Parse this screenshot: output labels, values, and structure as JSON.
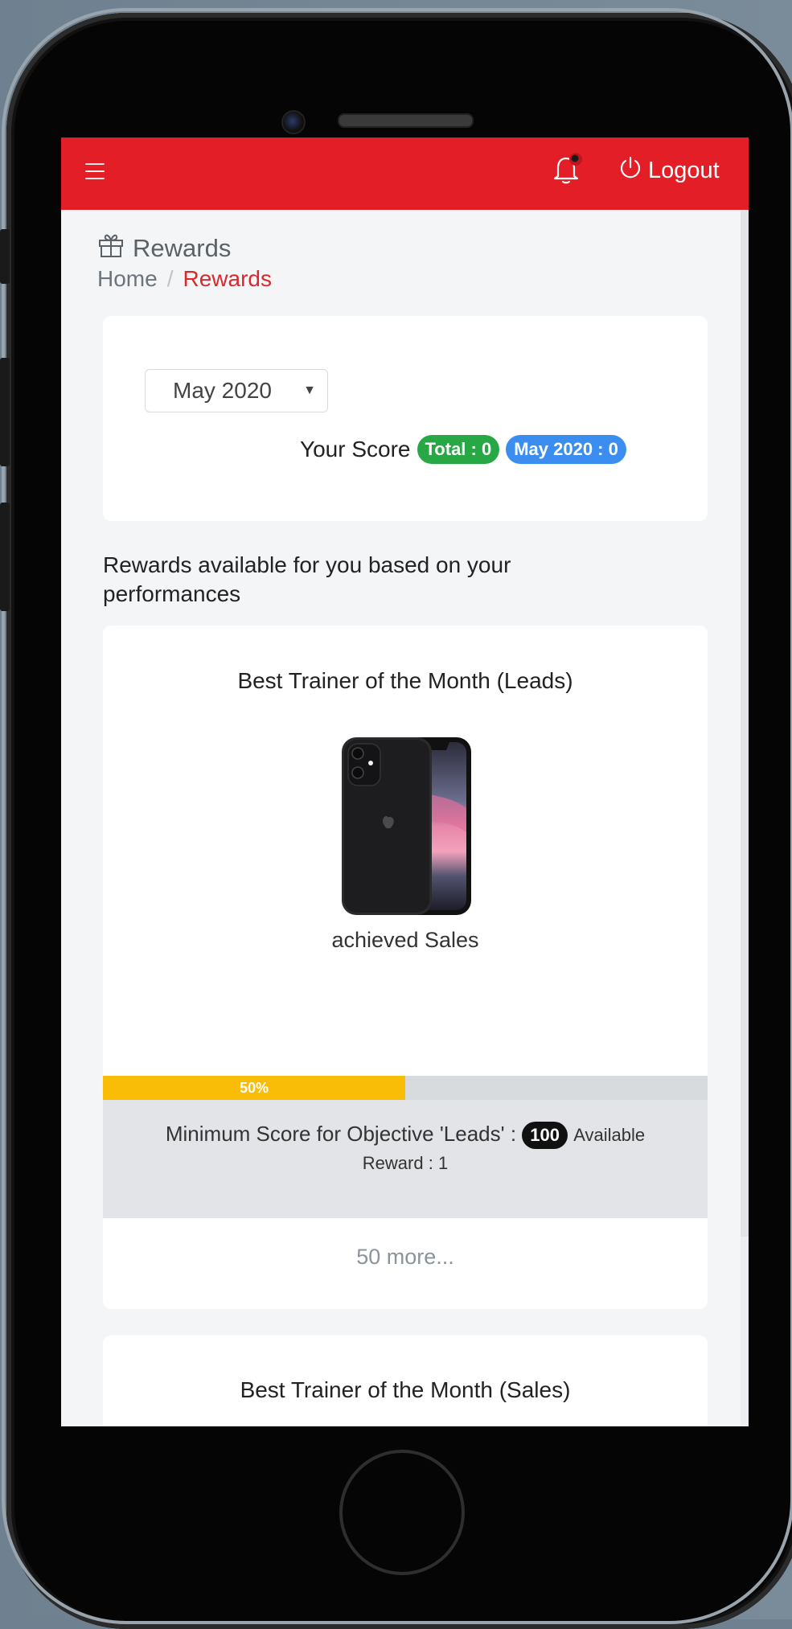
{
  "header": {
    "logout_label": "Logout"
  },
  "page": {
    "title": "Rewards",
    "breadcrumb": [
      {
        "label": "Home"
      },
      {
        "label": "Rewards"
      }
    ]
  },
  "score_card": {
    "selected_month": "May 2020",
    "score_label": "Your Score",
    "total_badge": "Total : 0",
    "month_badge": "May 2020 : 0"
  },
  "rewards_section": {
    "heading": "Rewards available for you based on your performances"
  },
  "rewards": [
    {
      "title": "Best Trainer of the Month (Leads)",
      "caption": "achieved Sales",
      "progress_label": "50%",
      "progress_percent": 50,
      "objective_text": "Minimum Score for Objective 'Leads' :",
      "objective_score": "100",
      "available_text": "Available",
      "reward_text": "Reward : 1",
      "more_link": "50 more..."
    },
    {
      "title": "Best Trainer of the Month (Sales)"
    }
  ],
  "colors": {
    "brand_red": "#e31e26",
    "progress_yellow": "#f9bd08",
    "badge_green": "#28a745",
    "badge_blue": "#3b8ef0"
  }
}
